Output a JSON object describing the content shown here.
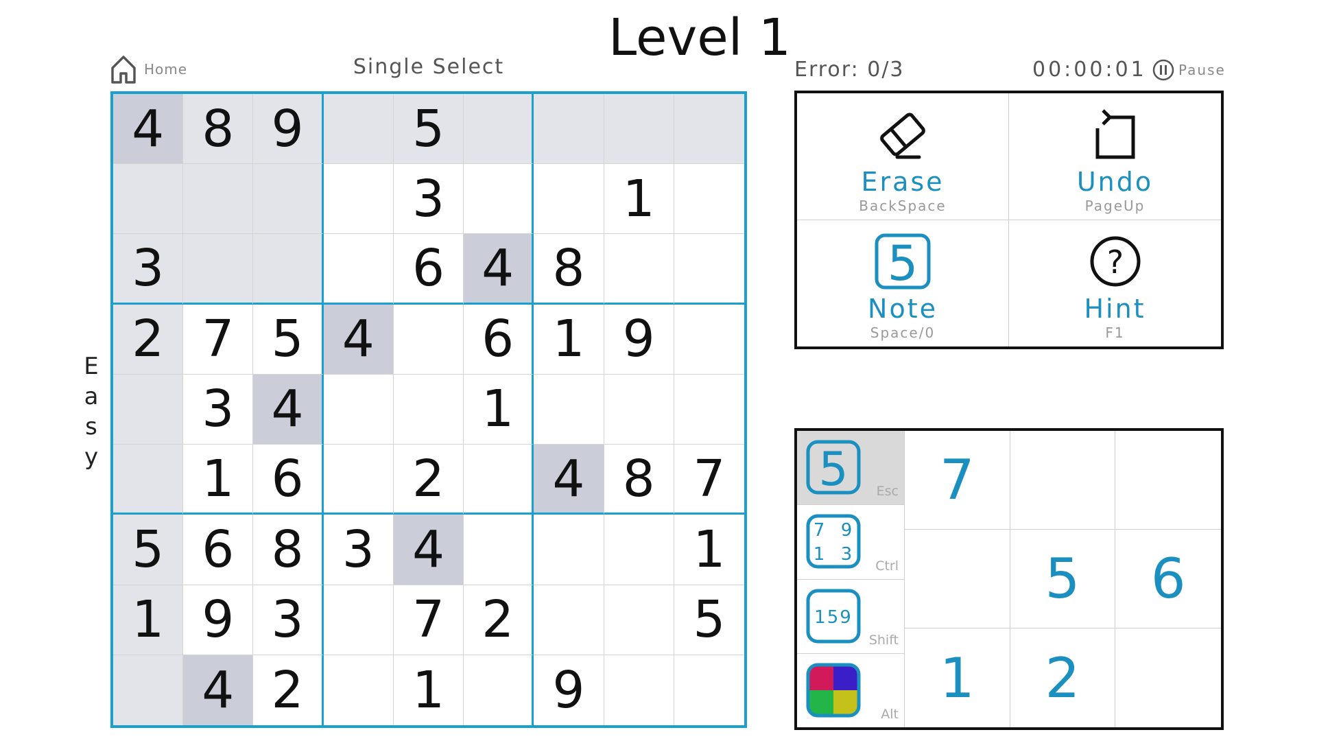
{
  "title": "Level 1",
  "home_label": "Home",
  "select_mode": "Single Select",
  "difficulty": [
    "E",
    "a",
    "s",
    "y"
  ],
  "errors": "Error: 0/3",
  "timer": "00:00:01",
  "pause_label": "Pause",
  "accent_color": "#1aa0cf",
  "grid": [
    [
      "4",
      "8",
      "9",
      "",
      "5",
      "",
      "",
      "",
      ""
    ],
    [
      "",
      "",
      "",
      "",
      "3",
      "",
      "",
      "1",
      ""
    ],
    [
      "3",
      "",
      "",
      "",
      "6",
      "4",
      "8",
      "",
      ""
    ],
    [
      "2",
      "7",
      "5",
      "4",
      "",
      "6",
      "1",
      "9",
      ""
    ],
    [
      "",
      "3",
      "4",
      "",
      "",
      "1",
      "",
      "",
      ""
    ],
    [
      "",
      "1",
      "6",
      "",
      "2",
      "",
      "4",
      "8",
      "7"
    ],
    [
      "5",
      "6",
      "8",
      "3",
      "4",
      "",
      "",
      "",
      "1"
    ],
    [
      "1",
      "9",
      "3",
      "",
      "7",
      "2",
      "",
      "",
      "5"
    ],
    [
      "",
      "4",
      "2",
      "",
      "1",
      "",
      "9",
      "",
      ""
    ]
  ],
  "selected_cell": [
    0,
    0
  ],
  "tools": [
    {
      "name": "Erase",
      "key": "BackSpace",
      "icon": "eraser-icon"
    },
    {
      "name": "Undo",
      "key": "PageUp",
      "icon": "undo-icon"
    },
    {
      "name": "Note",
      "key": "Space/0",
      "icon": "note-icon",
      "icon_text": "5"
    },
    {
      "name": "Hint",
      "key": "F1",
      "icon": "hint-icon",
      "icon_text": "?"
    }
  ],
  "modes": [
    {
      "key": "Esc",
      "icon": "single-digit-mode-icon",
      "icon_text": "5",
      "active": true
    },
    {
      "key": "Ctrl",
      "icon": "corner-notes-mode-icon",
      "icon_text": [
        "7",
        "9",
        "1",
        "3"
      ]
    },
    {
      "key": "Shift",
      "icon": "center-notes-mode-icon",
      "icon_text": "159"
    },
    {
      "key": "Alt",
      "icon": "color-mode-icon",
      "colors": [
        "#d01a5a",
        "#3a1fc9",
        "#23b548",
        "#c4c21a"
      ]
    }
  ],
  "numpad": [
    "7",
    "",
    "",
    "",
    "5",
    "6",
    "1",
    "2",
    ""
  ]
}
